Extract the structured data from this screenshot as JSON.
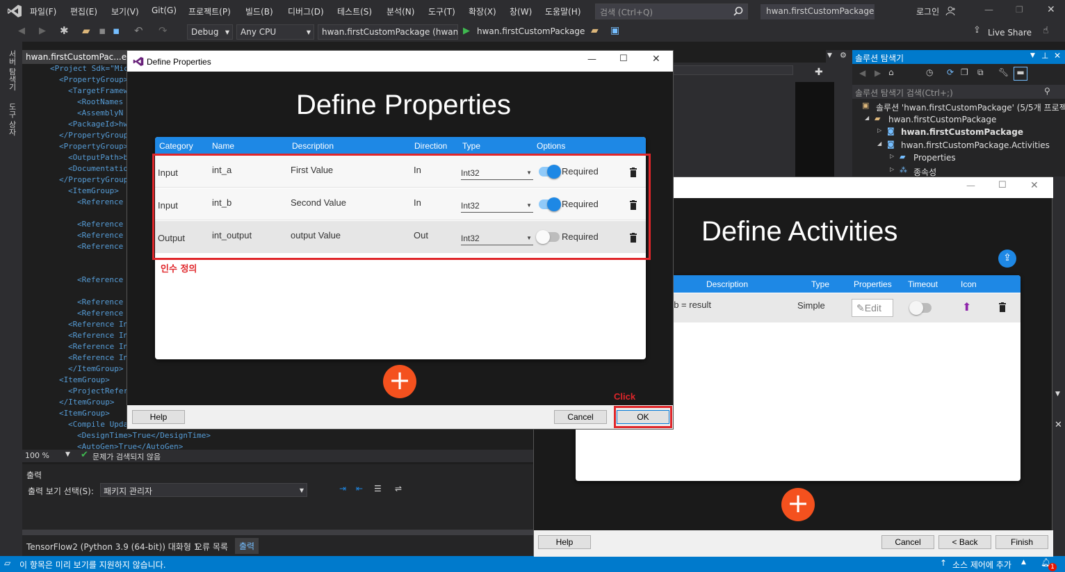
{
  "menu": {
    "items": [
      "파일(F)",
      "편집(E)",
      "보기(V)",
      "Git(G)",
      "프로젝트(P)",
      "빌드(B)",
      "디버그(D)",
      "테스트(S)",
      "분석(N)",
      "도구(T)",
      "확장(X)",
      "창(W)",
      "도움말(H)"
    ],
    "search_placeholder": "검색 (Ctrl+Q)",
    "solution_title": "hwan.firstCustomPackage",
    "login": "로그인"
  },
  "toolbar": {
    "config": "Debug",
    "platform": "Any CPU",
    "startup_project": "hwan.firstCustomPackage (hwan.f",
    "run_target": "hwan.firstCustomPackage",
    "live_share": "Live Share"
  },
  "left_strip": {
    "tabs": [
      "서버 탐색기",
      "도구 상자"
    ]
  },
  "editor": {
    "tab_title": "hwan.firstCustomPac...e.Ac",
    "lines": [
      {
        "text": "<Project Sdk=\"Mic",
        "indent": 0
      },
      {
        "text": "<PropertyGroup>",
        "indent": 1
      },
      {
        "text": "<TargetFramew",
        "indent": 2
      },
      {
        "text": "<RootNames",
        "indent": 3
      },
      {
        "text": "<AssemblyN",
        "indent": 3
      },
      {
        "text": "<PackageId>hwa",
        "indent": 2
      },
      {
        "text": "</PropertyGroup>",
        "indent": 1
      },
      {
        "text": "<PropertyGroup>",
        "indent": 1
      },
      {
        "text": "<OutputPath>b",
        "indent": 2
      },
      {
        "text": "<Documentation",
        "indent": 2
      },
      {
        "text": "</PropertyGroup>",
        "indent": 1
      },
      {
        "text": "<ItemGroup>",
        "indent": 2
      },
      {
        "text": "<Reference",
        "indent": 3
      },
      {
        "text": "",
        "indent": 3
      },
      {
        "text": "<Reference",
        "indent": 3
      },
      {
        "text": "<Reference",
        "indent": 3
      },
      {
        "text": "<Reference",
        "indent": 3
      },
      {
        "text": "",
        "indent": 3
      },
      {
        "text": "",
        "indent": 3
      },
      {
        "text": "<Reference",
        "indent": 3
      },
      {
        "text": "",
        "indent": 3
      },
      {
        "text": "<Reference",
        "indent": 3
      },
      {
        "text": "<Reference",
        "indent": 3
      },
      {
        "text": "<Reference Inc",
        "indent": 2
      },
      {
        "text": "<Reference Inc",
        "indent": 2
      },
      {
        "text": "<Reference Inc",
        "indent": 2
      },
      {
        "text": "<Reference Inc",
        "indent": 2
      },
      {
        "text": "</ItemGroup>",
        "indent": 2
      },
      {
        "text": "<ItemGroup>",
        "indent": 1
      },
      {
        "text": "<ProjectRefere",
        "indent": 2
      },
      {
        "text": "</ItemGroup>",
        "indent": 1
      },
      {
        "text": "<ItemGroup>",
        "indent": 1
      },
      {
        "text": "<Compile Upda",
        "indent": 2
      },
      {
        "text": "<DesignTime>True</DesignTime>",
        "indent": 3
      },
      {
        "text": "<AutoGen>True</AutoGen>",
        "indent": 3
      }
    ],
    "zoom": "100 %",
    "issues": "문제가 검색되지 않음"
  },
  "output": {
    "title": "출력",
    "source_label": "출력 보기 선택(S):",
    "source_value": "패키지 관리자",
    "bottom_tabs": [
      "TensorFlow2 (Python 3.9 (64-bit)) 대화형 1",
      "오류 목록",
      "출력"
    ]
  },
  "status": {
    "message": "이 항목은 미리 보기를 지원하지 않습니다.",
    "source_control": "소스 제어에 추가",
    "notifications": "1"
  },
  "solution_explorer": {
    "title": "솔루션 탐색기",
    "search_placeholder": "솔루션 탐색기 검색(Ctrl+;)",
    "items": [
      {
        "label": "솔루션 'hwan.firstCustomPackage' (5/5개 프로젝트",
        "level": 0,
        "bold": false
      },
      {
        "label": "hwan.firstCustomPackage",
        "level": 1,
        "bold": false
      },
      {
        "label": "hwan.firstCustomPackage",
        "level": 2,
        "bold": true
      },
      {
        "label": "hwan.firstCustomPackage.Activities",
        "level": 2,
        "bold": false
      },
      {
        "label": "Properties",
        "level": 3,
        "bold": false
      },
      {
        "label": "종속성",
        "level": 3,
        "bold": false
      }
    ]
  },
  "define_activities": {
    "heading": "Define Activities",
    "columns": [
      "Description",
      "Type",
      "Properties",
      "Timeout",
      "Icon"
    ],
    "row": {
      "description": "+ b = result",
      "type": "Simple",
      "edit_label": "Edit",
      "timeout_on": false
    },
    "buttons": {
      "help": "Help",
      "cancel": "Cancel",
      "back": "< Back",
      "finish": "Finish"
    },
    "add_symbol": "+"
  },
  "define_properties": {
    "window_title": "Define Properties",
    "heading": "Define Properties",
    "columns": [
      "Category",
      "Name",
      "Description",
      "Direction",
      "Type",
      "Options"
    ],
    "rows": [
      {
        "category": "Input",
        "name": "int_a",
        "description": "First Value",
        "direction": "In",
        "type": "Int32",
        "required_label": "Required",
        "required": true
      },
      {
        "category": "Input",
        "name": "int_b",
        "description": "Second Value",
        "direction": "In",
        "type": "Int32",
        "required_label": "Required",
        "required": true
      },
      {
        "category": "Output",
        "name": "int_output",
        "description": "output Value",
        "direction": "Out",
        "type": "Int32",
        "required_label": "Required",
        "required": false
      }
    ],
    "annotation_rows": "인수 정의",
    "annotation_ok": "Click",
    "buttons": {
      "help": "Help",
      "cancel": "Cancel",
      "ok": "OK"
    },
    "add_symbol": "+"
  },
  "colors": {
    "accent": "#1e88e5",
    "fab": "#f4511e",
    "annotation": "#e0262a",
    "status_bar": "#007acc"
  }
}
